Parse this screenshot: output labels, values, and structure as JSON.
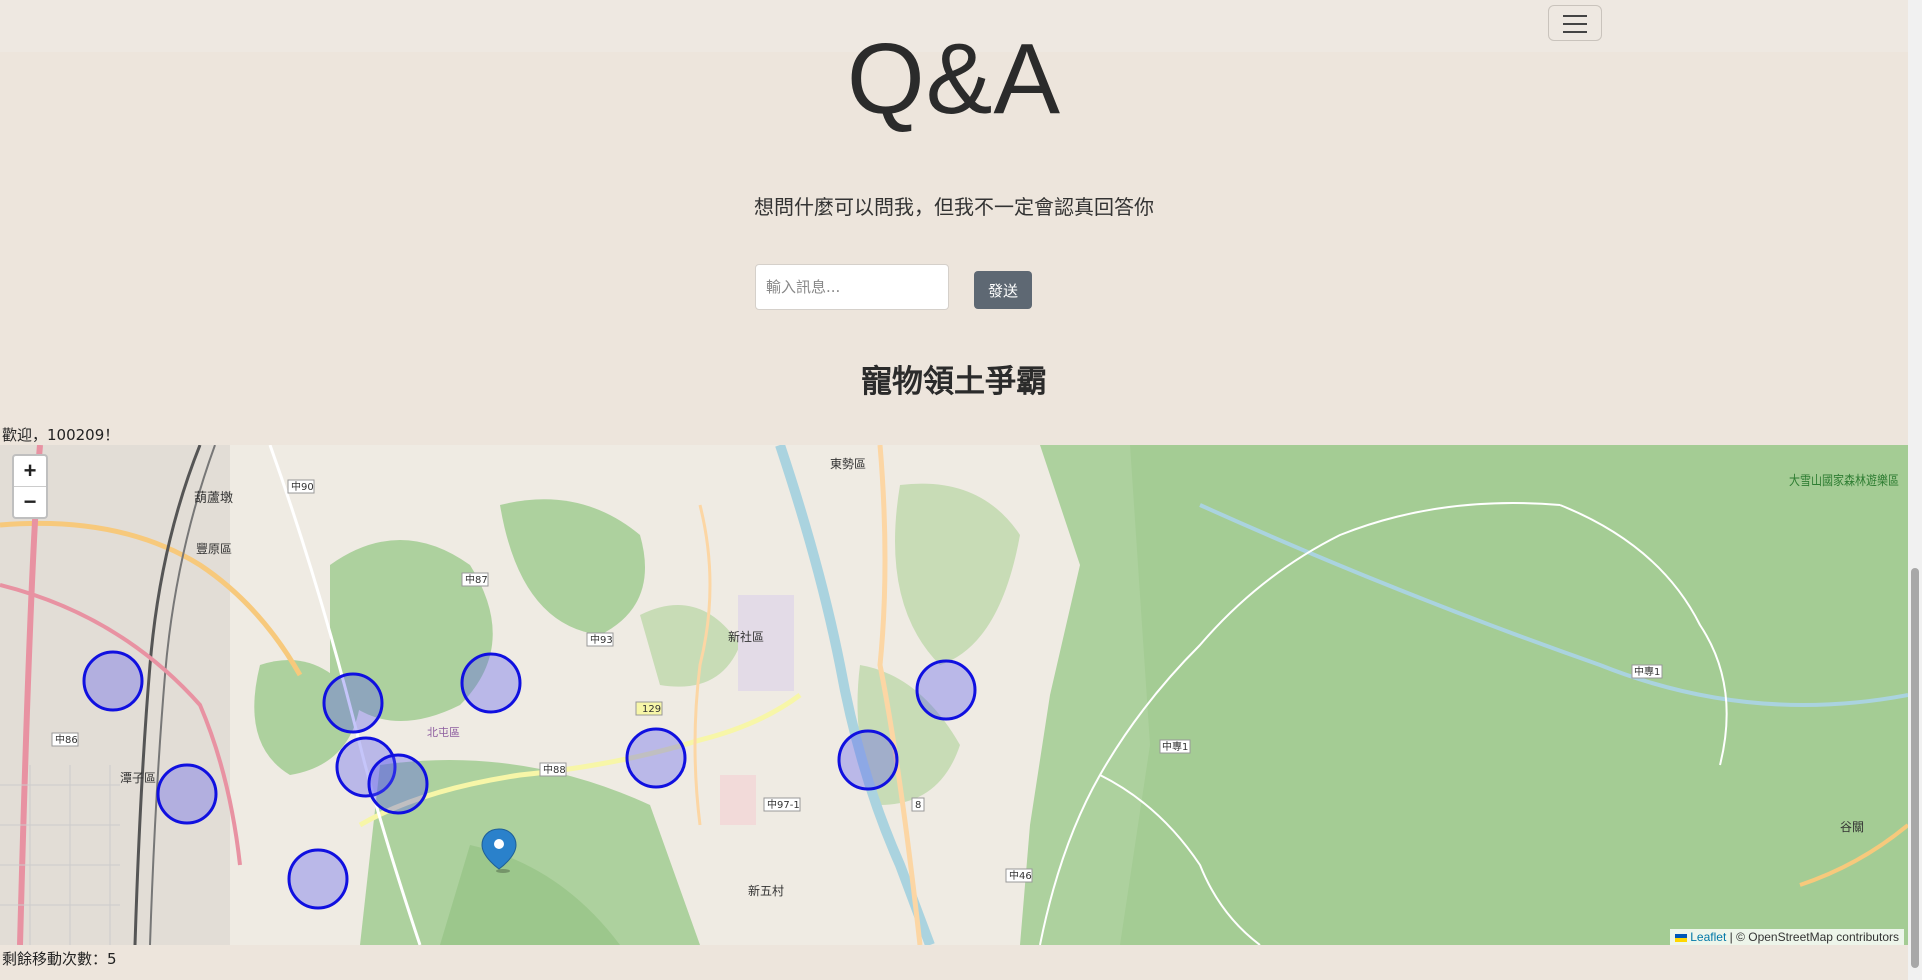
{
  "header": {
    "title": "Q&A",
    "subtitle": "想問什麼可以問我，但我不一定會認真回答你"
  },
  "chat": {
    "input_placeholder": "輸入訊息...",
    "send_label": "發送"
  },
  "game": {
    "title": "寵物領土爭霸",
    "welcome": "歡迎，100209！",
    "remaining_moves": "剩餘移動次數：5"
  },
  "map": {
    "zoom_in": "+",
    "zoom_out": "−",
    "attribution_leaflet": "Leaflet",
    "attribution_rest": " | © OpenStreetMap contributors",
    "territory_color": "#1010e0",
    "labels": {
      "huludun": "葫蘆墩",
      "fengyuan": "豐原區",
      "xinshe": "新社區",
      "dongshi": "東勢區",
      "tanzi": "潭子區",
      "xinwu": "新五村",
      "daxueshan": "大雪山國家森林遊樂區",
      "gukeng": "谷關",
      "beiqu": "北屯區",
      "r90": "中90",
      "r87": "中87",
      "r93": "中93",
      "r88": "中88",
      "r86": "中86",
      "r129": "129",
      "r97": "中97-1",
      "r8": "8",
      "r46": "中46",
      "rzz1": "中專1"
    }
  }
}
